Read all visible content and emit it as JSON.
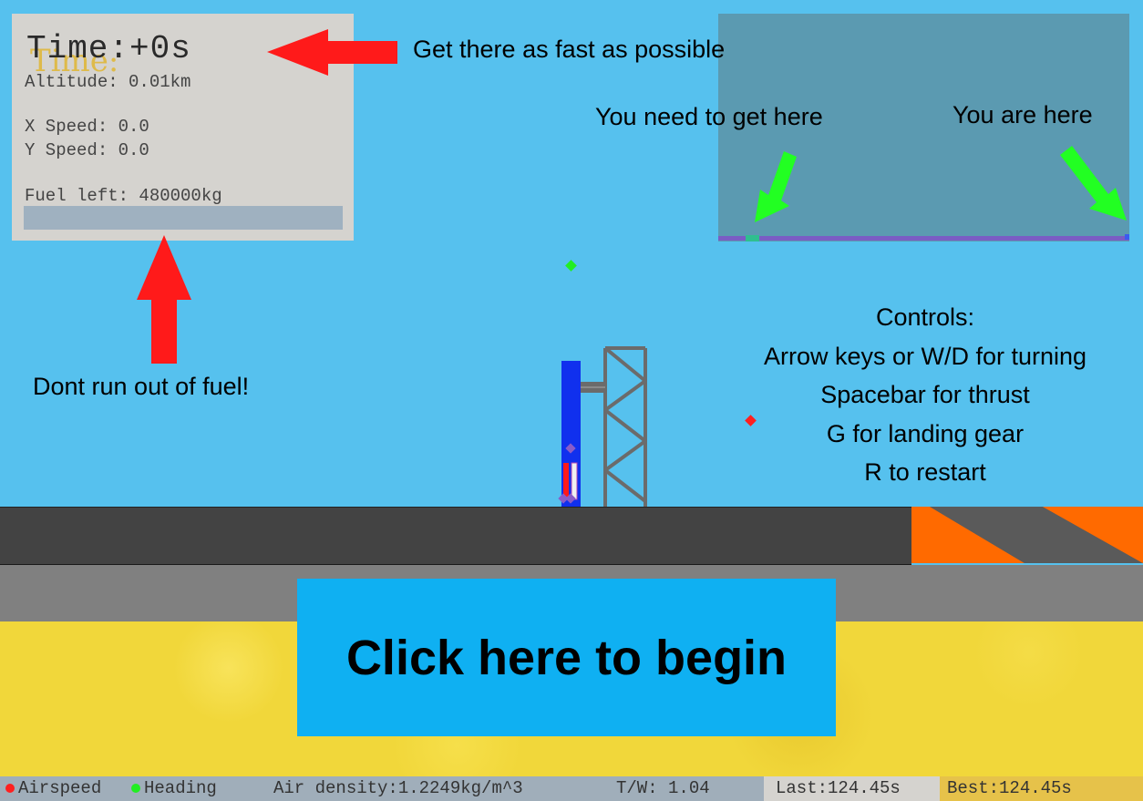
{
  "hud": {
    "time": "Time:+0s",
    "time_shadow": "Time:",
    "altitude": "Altitude: 0.01km",
    "x_speed": "X Speed: 0.0",
    "y_speed": "Y Speed: 0.0",
    "fuel": "Fuel left: 480000kg",
    "fuel_fraction": 1.0
  },
  "annotations": {
    "time_hint": "Get there as fast as possible",
    "fuel_hint": "Dont run out of fuel!",
    "target_hint": "You need to get here",
    "player_hint": "You are here"
  },
  "controls": {
    "title": "Controls:",
    "lines": [
      "Arrow keys or W/D for turning",
      "Spacebar for thrust",
      "G for landing gear",
      "R to restart"
    ]
  },
  "start_button": {
    "label": "Click here to begin"
  },
  "statusbar": {
    "airspeed_label": "Airspeed",
    "heading_label": "Heading",
    "air_density": "Air density:1.2249kg/m^3",
    "tw": "T/W: 1.04",
    "last": "Last:124.45s",
    "best": "Best:124.45s"
  },
  "colors": {
    "sky": "#56c1ee",
    "arrow_red": "#ff1a1a",
    "arrow_green": "#22ff22",
    "airspeed_dot": "#ff2020",
    "heading_dot": "#22ee22",
    "rocket_body": "#1030ee"
  }
}
